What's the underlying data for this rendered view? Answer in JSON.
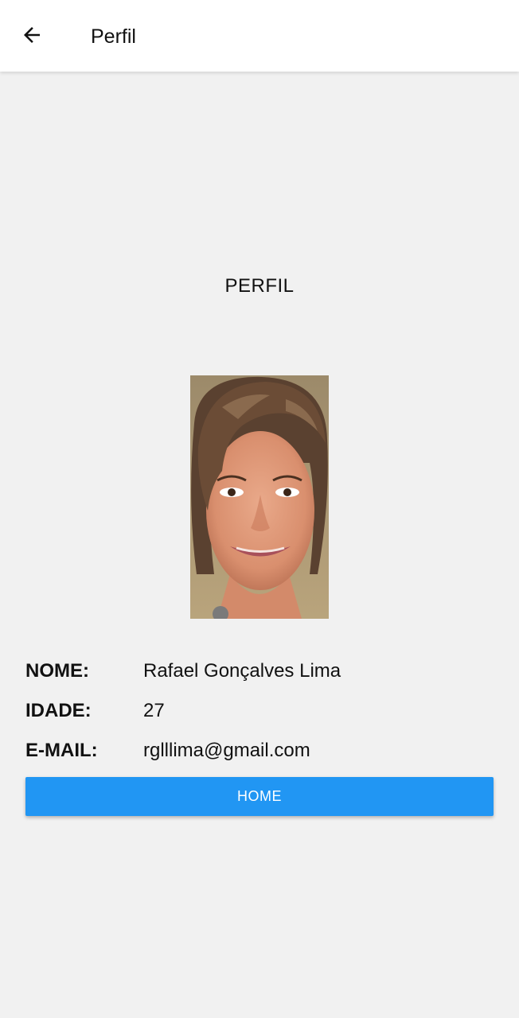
{
  "app_bar": {
    "title": "Perfil",
    "back_icon": "arrow-left-icon",
    "background": "#ffffff"
  },
  "main": {
    "heading": "PERFIL",
    "avatar_icon": "profile-photo",
    "fields": [
      {
        "label": "NOME:",
        "value": "Rafael Gonçalves Lima"
      },
      {
        "label": "IDADE:",
        "value": "27"
      },
      {
        "label": "E-MAIL:",
        "value": "rglllima@gmail.com"
      }
    ],
    "home_button": {
      "label": "HOME",
      "color": "#2196f3"
    }
  },
  "colors": {
    "background": "#f1f1f1",
    "accent": "#2196f3"
  }
}
